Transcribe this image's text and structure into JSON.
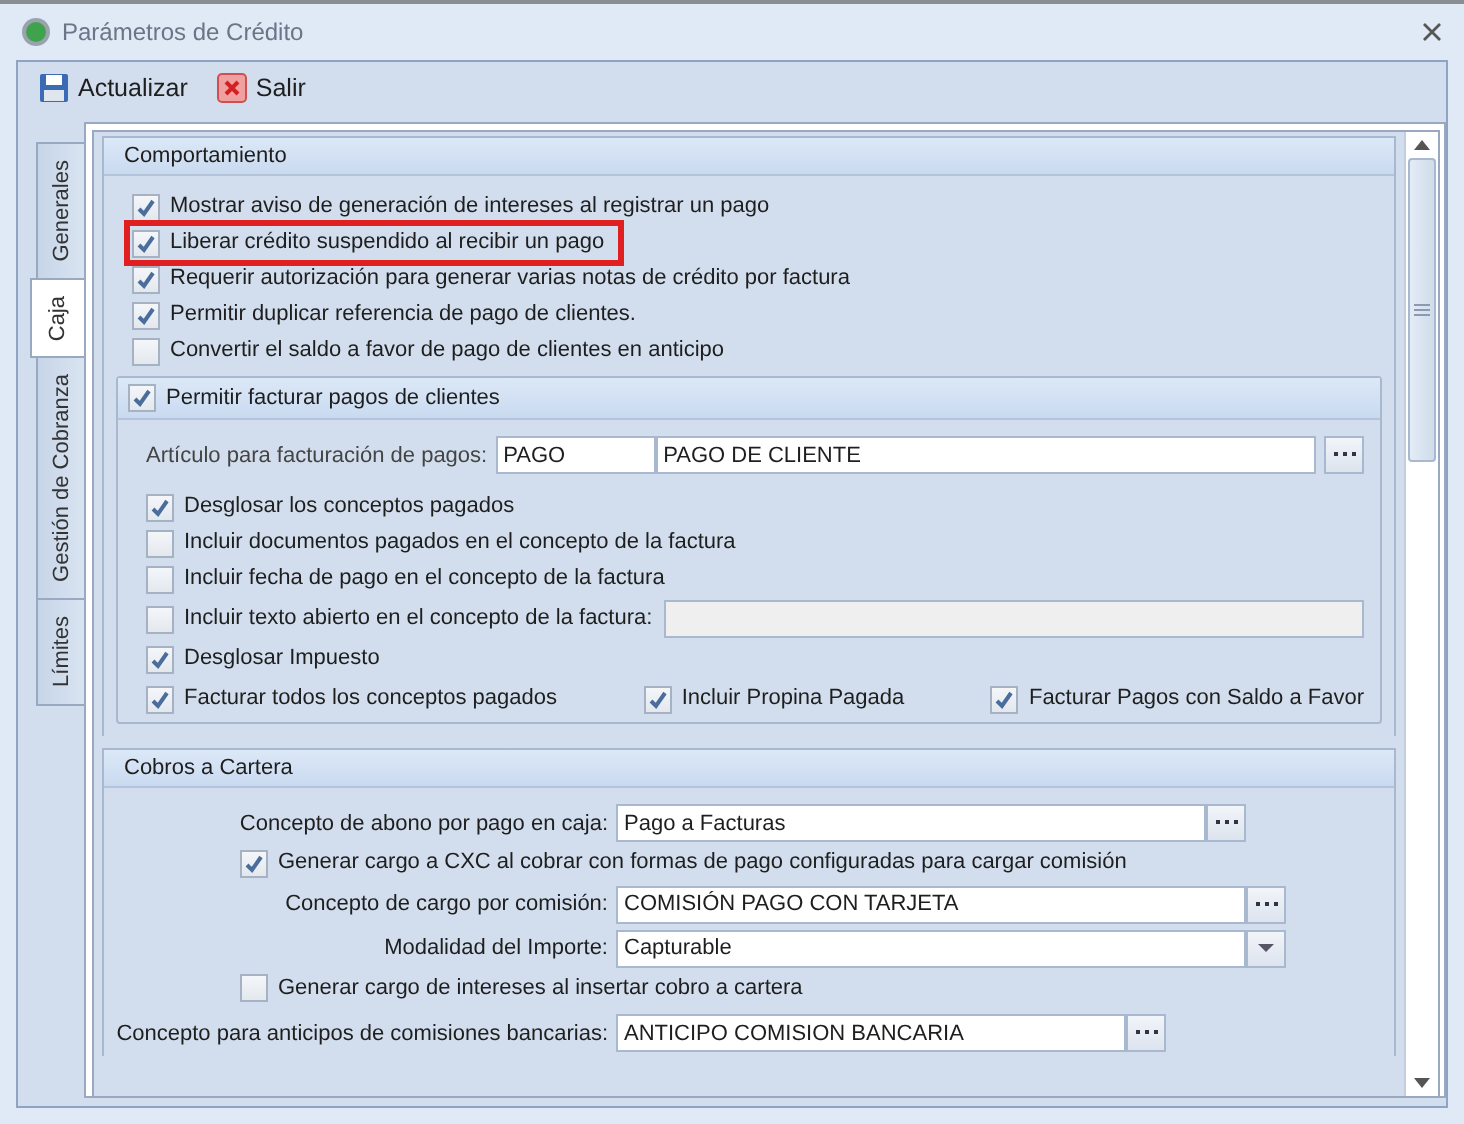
{
  "window": {
    "title": "Parámetros de Crédito"
  },
  "toolbar": [
    {
      "kind": "save",
      "label": "Actualizar"
    },
    {
      "kind": "exit",
      "label": "Salir"
    }
  ],
  "tabs": [
    {
      "label": "Generales",
      "selected": false
    },
    {
      "label": "Caja",
      "selected": true
    },
    {
      "label": "Gestión de Cobranza",
      "selected": false
    },
    {
      "label": "Límites",
      "selected": false
    }
  ],
  "comportamiento": {
    "title": "Comportamiento",
    "options": [
      {
        "label": "Mostrar aviso de generación de intereses al registrar un pago",
        "checked": true,
        "highlighted": false
      },
      {
        "label": "Liberar crédito suspendido al recibir un pago",
        "checked": true,
        "highlighted": true
      },
      {
        "label": "Requerir autorización para generar varias notas de crédito por factura",
        "checked": true,
        "highlighted": false
      },
      {
        "label": "Permitir duplicar referencia de pago de clientes.",
        "checked": true,
        "highlighted": false
      },
      {
        "label": "Convertir el saldo a favor de pago de clientes en anticipo",
        "checked": false,
        "highlighted": false
      }
    ]
  },
  "facturar": {
    "label": "Permitir facturar pagos de clientes",
    "checked": true,
    "articulo": {
      "label": "Artículo para facturación de pagos:",
      "code": "PAGO",
      "name": "PAGO DE CLIENTE"
    },
    "options": [
      {
        "kind": "check",
        "label": "Desglosar los conceptos pagados",
        "checked": true
      },
      {
        "kind": "check",
        "label": "Incluir documentos pagados en el concepto de la factura",
        "checked": false
      },
      {
        "kind": "check",
        "label": "Incluir fecha de pago en el concepto de la factura",
        "checked": false
      },
      {
        "kind": "text",
        "label": "Incluir texto abierto en el concepto de la factura:",
        "checked": false
      },
      {
        "kind": "check",
        "label": "Desglosar Impuesto",
        "checked": true
      }
    ],
    "bottom_options": [
      {
        "label": "Facturar todos los conceptos pagados",
        "checked": true
      },
      {
        "label": "Incluir Propina Pagada",
        "checked": true
      },
      {
        "label": "Facturar Pagos con Saldo a Favor",
        "checked": true
      }
    ]
  },
  "cobros": {
    "title": "Cobros a Cartera",
    "rows": [
      {
        "kind": "lookup",
        "label": "Concepto de abono por pago en caja:",
        "value": "Pago a Facturas"
      },
      {
        "kind": "check",
        "label": "Generar cargo a CXC al cobrar con formas de pago configuradas para cargar comisión",
        "checked": true
      },
      {
        "kind": "lookup",
        "label": "Concepto de cargo por comisión:",
        "value": "COMISIÓN PAGO CON TARJETA"
      },
      {
        "kind": "select",
        "label": "Modalidad del Importe:",
        "value": "Capturable"
      },
      {
        "kind": "check",
        "label": "Generar cargo de intereses al insertar cobro a cartera",
        "checked": false
      },
      {
        "kind": "lookup",
        "label": "Concepto para anticipos de comisiones bancarias:",
        "value": "ANTICIPO COMISION BANCARIA"
      }
    ]
  }
}
